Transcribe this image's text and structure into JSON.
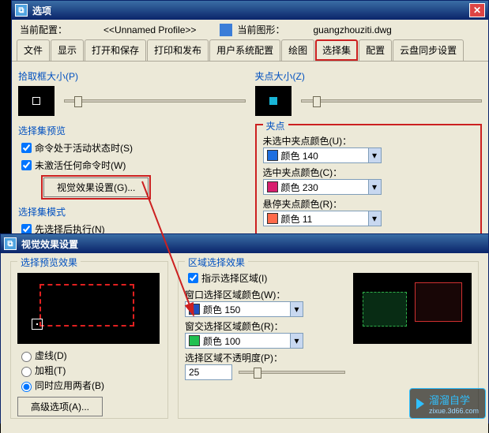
{
  "win1": {
    "title": "选项",
    "hdr": {
      "cur_profile_label": "当前配置：",
      "cur_profile_value": "<<Unnamed Profile>>",
      "cur_drawing_label": "当前图形：",
      "cur_drawing_value": "guangzhouziti.dwg"
    },
    "tabs": [
      "文件",
      "显示",
      "打开和保存",
      "打印和发布",
      "用户系统配置",
      "绘图",
      "选择集",
      "配置",
      "云盘同步设置"
    ],
    "left": {
      "pickbox_title": "拾取框大小(P)",
      "sel_preview_title": "选择集预览",
      "chk_active": "命令处于活动状态时(S)",
      "chk_nocmd": "未激活任何命令时(W)",
      "btn_visual": "视觉效果设置(G)...",
      "sel_mode_title": "选择集模式",
      "chk_first": "先选择后执行(N)"
    },
    "right": {
      "gripsize_title": "夹点大小(Z)",
      "grip_title": "夹点",
      "lbl_unsel": "未选中夹点颜色(U)：",
      "color_unsel": {
        "text": "颜色 140",
        "hex": "#1f6fe0"
      },
      "lbl_sel": "选中夹点颜色(C)：",
      "color_sel": {
        "text": "颜色 230",
        "hex": "#d81e6e"
      },
      "lbl_hover": "悬停夹点颜色(R)：",
      "color_hover": {
        "text": "颜色 11",
        "hex": "#ff6a4a"
      }
    }
  },
  "win2": {
    "title": "视觉效果设置",
    "left": {
      "title": "选择预览效果",
      "r_dash": "虚线(D)",
      "r_thick": "加粗(T)",
      "r_both": "同时应用两者(B)",
      "btn_adv": "高级选项(A)..."
    },
    "right": {
      "title": "区域选择效果",
      "chk_indicate": "指示选择区域(I)",
      "lbl_wincolor": "窗口选择区域颜色(W)：",
      "color_win": {
        "text": "颜色 150",
        "hex": "#2050c0"
      },
      "lbl_crosscolor": "窗交选择区域颜色(R)：",
      "color_cross": {
        "text": "颜色 100",
        "hex": "#20c050"
      },
      "lbl_opacity": "选择区域不透明度(P)：",
      "opacity_value": "25"
    }
  },
  "logo": {
    "brand": "溜溜自学",
    "url": "zixue.3d66.com"
  }
}
